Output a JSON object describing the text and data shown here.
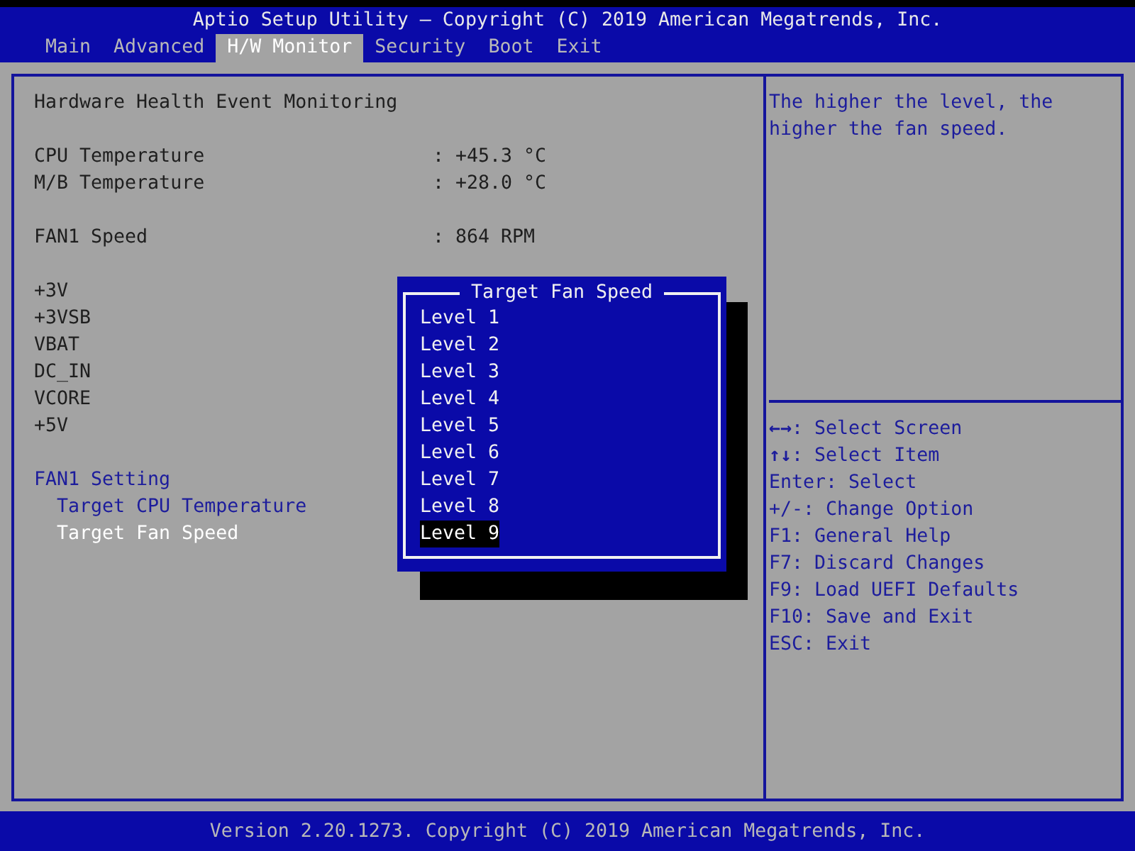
{
  "header": {
    "title": "Aptio Setup Utility – Copyright (C) 2019 American Megatrends, Inc."
  },
  "tabs": [
    {
      "label": "Main",
      "selected": false
    },
    {
      "label": "Advanced",
      "selected": false
    },
    {
      "label": "H/W Monitor",
      "selected": true
    },
    {
      "label": "Security",
      "selected": false
    },
    {
      "label": "Boot",
      "selected": false
    },
    {
      "label": "Exit",
      "selected": false
    }
  ],
  "main": {
    "sections": [
      {
        "items": [
          {
            "kind": "info",
            "label": "Hardware Health Event Monitoring"
          }
        ]
      },
      {
        "items": [
          {
            "kind": "reading",
            "label": "CPU Temperature",
            "value": ": +45.3 °C"
          },
          {
            "kind": "reading",
            "label": "M/B Temperature",
            "value": ": +28.0 °C"
          }
        ]
      },
      {
        "items": [
          {
            "kind": "reading",
            "label": "FAN1 Speed",
            "value": ": 864 RPM"
          }
        ]
      },
      {
        "items": [
          {
            "kind": "info",
            "label": "+3V"
          },
          {
            "kind": "info",
            "label": "+3VSB"
          },
          {
            "kind": "info",
            "label": "VBAT"
          },
          {
            "kind": "info",
            "label": "DC_IN"
          },
          {
            "kind": "info",
            "label": "VCORE"
          },
          {
            "kind": "info",
            "label": "+5V"
          }
        ]
      },
      {
        "items": [
          {
            "kind": "group",
            "label": "FAN1 Setting",
            "children": [
              {
                "label": "Target CPU Temperature",
                "selected": false
              },
              {
                "label": "Target Fan Speed",
                "selected": true
              }
            ]
          }
        ]
      }
    ]
  },
  "help": {
    "text": "The higher the level, the higher the fan speed.",
    "keys": [
      "**←→**: Select Screen",
      "**↑↓**: Select Item",
      "Enter: Select",
      "+/-: Change Option",
      "F1: General Help",
      "F7: Discard Changes",
      "F9: Load UEFI Defaults",
      "F10: Save and Exit",
      "ESC: Exit"
    ]
  },
  "popup": {
    "title": "Target Fan Speed",
    "options": [
      {
        "label": "Level 1",
        "selected": false
      },
      {
        "label": "Level 2",
        "selected": false
      },
      {
        "label": "Level 3",
        "selected": false
      },
      {
        "label": "Level 4",
        "selected": false
      },
      {
        "label": "Level 5",
        "selected": false
      },
      {
        "label": "Level 6",
        "selected": false
      },
      {
        "label": "Level 7",
        "selected": false
      },
      {
        "label": "Level 8",
        "selected": false
      },
      {
        "label": "Level 9",
        "selected": true
      }
    ]
  },
  "footer": {
    "text": "Version 2.20.1273. Copyright (C) 2019 American Megatrends, Inc."
  }
}
